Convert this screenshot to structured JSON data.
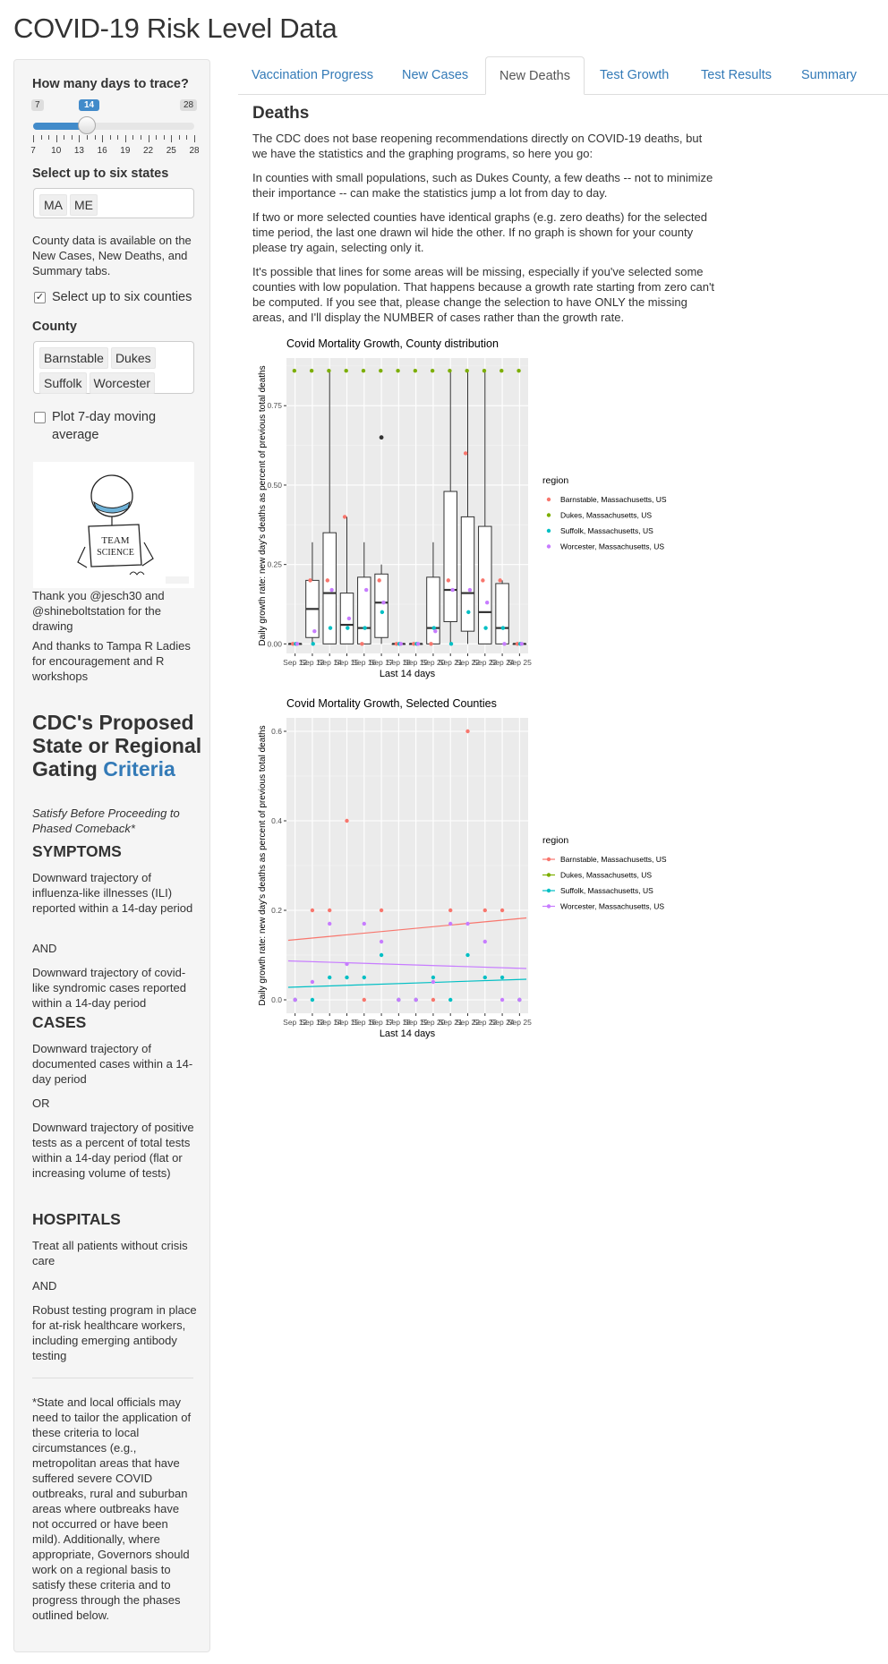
{
  "page_title": "COVID-19 Risk Level Data",
  "sidebar": {
    "days_label": "How many days to trace?",
    "slider": {
      "min_label": "7",
      "max_label": "28",
      "value_label": "14",
      "min": 7,
      "max": 28,
      "value": 14,
      "tick_labels": [
        "7",
        "10",
        "13",
        "16",
        "19",
        "22",
        "25",
        "28"
      ]
    },
    "states_label": "Select up to six states",
    "states": [
      "MA",
      "ME"
    ],
    "county_note": "County data is available on the New Cases, New Deaths, and Summary tabs.",
    "counties_checkbox_label": "Select up to six counties",
    "counties_checked": true,
    "county_label": "County",
    "counties": [
      "Barnstable",
      "Dukes",
      "Suffolk",
      "Worcester"
    ],
    "moving_avg_label": "Plot 7-day moving average",
    "moving_avg_checked": false,
    "drawing_text": [
      "TEAM",
      "SCIENCE"
    ],
    "thanks_1": "Thank you @jesch30 and @shineboltstation for the drawing",
    "thanks_2": "And thanks to Tampa R Ladies for encouragement and R workshops",
    "cdc_heading": "CDC's Proposed State or Regional Gating",
    "cdc_link": "Criteria",
    "cdc_subtitle": "Satisfy Before Proceeding to Phased Comeback*",
    "symptoms_heading": "SYMPTOMS",
    "symptoms_1": "Downward trajectory of influenza-like illnesses (ILI) reported within a 14-day period",
    "and_1": "AND",
    "symptoms_2": "Downward trajectory of covid-like syndromic cases reported within a 14-day period",
    "cases_heading": "CASES",
    "cases_1": "Downward trajectory of documented cases within a 14-day period",
    "or_1": "OR",
    "cases_2": "Downward trajectory of positive tests as a percent of total tests within a 14-day period (flat or increasing volume of tests)",
    "hospitals_heading": "HOSPITALS",
    "hospitals_1": "Treat all patients without crisis care",
    "and_2": "AND",
    "hospitals_2": "Robust testing program in place for at-risk healthcare workers, including emerging antibody testing",
    "footnote": "*State and local officials may need to tailor the application of these criteria to local circumstances (e.g., metropolitan areas that have suffered severe COVID outbreaks, rural and suburban areas where outbreaks have not occurred or have been mild). Additionally, where appropriate, Governors should work on a regional basis to satisfy these criteria and to progress through the phases outlined below."
  },
  "tabs": [
    {
      "label": "Vaccination Progress",
      "active": false
    },
    {
      "label": "New Cases",
      "active": false
    },
    {
      "label": "New Deaths",
      "active": true
    },
    {
      "label": "Test Growth",
      "active": false
    },
    {
      "label": "Test Results",
      "active": false
    },
    {
      "label": "Summary",
      "active": false
    }
  ],
  "main": {
    "heading": "Deaths",
    "p1": "The CDC does not base reopening recommendations directly on COVID-19 deaths, but we have the statistics and the graphing programs, so here you go:",
    "p2": "In counties with small populations, such as Dukes County, a few deaths -- not to minimize their importance -- can make the statistics jump a lot from day to day.",
    "p3": "If two or more selected counties have identical graphs (e.g. zero deaths) for the selected time period, the last one drawn wil hide the other. If no graph is shown for your county please try again, selecting only it.",
    "p4": "It's possible that lines for some areas will be missing, especially if you've selected some counties with low population. That happens because a growth rate starting from zero can't be computed. If you see that, please change the selection to have ONLY the missing areas, and I'll display the NUMBER of cases rather than the growth rate."
  },
  "colors": {
    "Barnstable": "#F8766D",
    "Dukes": "#7CAE00",
    "Suffolk": "#00BFC4",
    "Worcester": "#C77CFF",
    "accent": "#337ab7",
    "panel_bg": "#EBEBEB"
  },
  "chart_data": [
    {
      "type": "box",
      "title": "Covid Mortality Growth, County distribution",
      "xlabel": "Last 14 days",
      "ylabel": "Daily growth rate: new day's deaths as percent of previous total deaths",
      "categories": [
        "Sep 12",
        "Sep 13",
        "Sep 14",
        "Sep 15",
        "Sep 16",
        "Sep 17",
        "Sep 18",
        "Sep 19",
        "Sep 20",
        "Sep 21",
        "Sep 22",
        "Sep 23",
        "Sep 24",
        "Sep 25"
      ],
      "y_ticks": [
        "0.00",
        "0.25",
        "0.50",
        "0.75"
      ],
      "ylim": [
        -0.03,
        0.9
      ],
      "legend_title": "region",
      "legend_position": "right",
      "boxes": [
        {
          "low": 0,
          "q1": 0,
          "median": 0,
          "q3": 0,
          "high": 0
        },
        {
          "low": 0,
          "q1": 0.02,
          "median": 0.11,
          "q3": 0.2,
          "high": 0.32
        },
        {
          "low": 0,
          "q1": 0,
          "median": 0.16,
          "q3": 0.35,
          "high": 0.86
        },
        {
          "low": 0,
          "q1": 0,
          "median": 0.06,
          "q3": 0.16,
          "high": 0.4
        },
        {
          "low": 0,
          "q1": 0,
          "median": 0.05,
          "q3": 0.21,
          "high": 0.32
        },
        {
          "low": 0,
          "q1": 0.02,
          "median": 0.13,
          "q3": 0.22,
          "high": 0.25
        },
        {
          "low": 0,
          "q1": 0,
          "median": 0,
          "q3": 0,
          "high": 0
        },
        {
          "low": 0,
          "q1": 0,
          "median": 0,
          "q3": 0,
          "high": 0
        },
        {
          "low": 0,
          "q1": 0,
          "median": 0.05,
          "q3": 0.21,
          "high": 0.32
        },
        {
          "low": 0,
          "q1": 0.07,
          "median": 0.17,
          "q3": 0.48,
          "high": 0.86
        },
        {
          "low": 0,
          "q1": 0.04,
          "median": 0.16,
          "q3": 0.4,
          "high": 0.86
        },
        {
          "low": 0,
          "q1": 0,
          "median": 0.1,
          "q3": 0.37,
          "high": 0.86
        },
        {
          "low": 0,
          "q1": 0,
          "median": 0.05,
          "q3": 0.19,
          "high": 0.2
        },
        {
          "low": 0,
          "q1": 0,
          "median": 0,
          "q3": 0,
          "high": 0
        }
      ],
      "outliers": [
        {
          "x": 5,
          "y": 0.65
        }
      ],
      "series": [
        {
          "name": "Barnstable, Massachusetts, US",
          "values": [
            0,
            0.2,
            0.2,
            0.4,
            0,
            0.2,
            0,
            0,
            0,
            0.2,
            0.6,
            0.2,
            0.2,
            0
          ]
        },
        {
          "name": "Dukes, Massachusetts, US",
          "values": [
            0.86,
            0.86,
            0.86,
            0.86,
            0.86,
            0.86,
            0.86,
            0.86,
            0.86,
            0.86,
            0.86,
            0.86,
            0.86,
            0.86
          ]
        },
        {
          "name": "Suffolk, Massachusetts, US",
          "values": [
            0,
            0,
            0.05,
            0.05,
            0.05,
            0.1,
            0,
            0,
            0.05,
            0,
            0.1,
            0.05,
            0.05,
            0
          ]
        },
        {
          "name": "Worcester, Massachusetts, US",
          "values": [
            0,
            0.04,
            0.17,
            0.08,
            0.17,
            0.13,
            0,
            0,
            0.04,
            0.17,
            0.17,
            0.13,
            0,
            0
          ]
        }
      ]
    },
    {
      "type": "scatter",
      "title": "Covid Mortality Growth, Selected Counties",
      "xlabel": "Last 14 days",
      "ylabel": "Daily growth rate: new day's deaths as percent of previous total deaths",
      "categories": [
        "Sep 12",
        "Sep 13",
        "Sep 14",
        "Sep 15",
        "Sep 16",
        "Sep 17",
        "Sep 18",
        "Sep 19",
        "Sep 20",
        "Sep 21",
        "Sep 22",
        "Sep 23",
        "Sep 24",
        "Sep 25"
      ],
      "y_ticks": [
        "0.0",
        "0.2",
        "0.4",
        "0.6"
      ],
      "ylim": [
        -0.03,
        0.63
      ],
      "legend_title": "region",
      "legend_position": "right",
      "series": [
        {
          "name": "Barnstable, Massachusetts, US",
          "values": [
            0,
            0.2,
            0.2,
            0.4,
            0,
            0.2,
            0,
            0,
            0,
            0.2,
            0.6,
            0.2,
            0.2,
            0
          ],
          "trend": [
            0.133,
            0.183
          ]
        },
        {
          "name": "Dukes, Massachusetts, US",
          "values": [],
          "trend": null
        },
        {
          "name": "Suffolk, Massachusetts, US",
          "values": [
            0,
            0,
            0.05,
            0.05,
            0.05,
            0.1,
            0,
            0,
            0.05,
            0,
            0.1,
            0.05,
            0.05,
            0
          ],
          "trend": [
            0.028,
            0.046
          ]
        },
        {
          "name": "Worcester, Massachusetts, US",
          "values": [
            0,
            0.04,
            0.17,
            0.08,
            0.17,
            0.13,
            0,
            0,
            0.04,
            0.17,
            0.17,
            0.13,
            0,
            0
          ],
          "trend": [
            0.087,
            0.07
          ]
        }
      ]
    }
  ]
}
